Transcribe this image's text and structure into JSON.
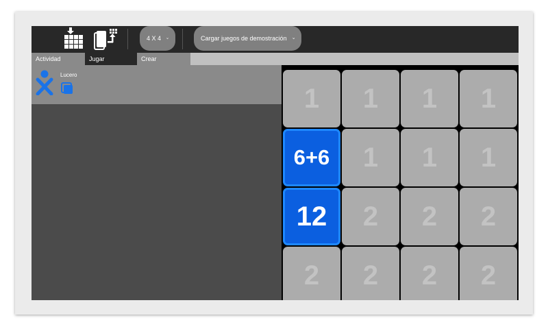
{
  "toolbar": {
    "size_combo": "4 X 4",
    "demo_combo": "Cargar juegos de demostración"
  },
  "tabs": [
    "Actividad",
    "Jugar",
    "Crear"
  ],
  "player": {
    "name": "Lucero"
  },
  "board": {
    "cards": [
      {
        "text": "1",
        "selected": false
      },
      {
        "text": "1",
        "selected": false
      },
      {
        "text": "1",
        "selected": false
      },
      {
        "text": "1",
        "selected": false
      },
      {
        "text": "6+6",
        "selected": true
      },
      {
        "text": "1",
        "selected": false
      },
      {
        "text": "1",
        "selected": false
      },
      {
        "text": "1",
        "selected": false
      },
      {
        "text": "12",
        "selected": true
      },
      {
        "text": "2",
        "selected": false
      },
      {
        "text": "2",
        "selected": false
      },
      {
        "text": "2",
        "selected": false
      },
      {
        "text": "2",
        "selected": false
      },
      {
        "text": "2",
        "selected": false
      },
      {
        "text": "2",
        "selected": false
      },
      {
        "text": "2",
        "selected": false
      }
    ]
  },
  "colors": {
    "toolbar": "#282828",
    "card": "#acacac",
    "card_text": "#c3c3c3",
    "selected_card": "#0b5fe0",
    "xo_blue": "#1a73e8"
  }
}
